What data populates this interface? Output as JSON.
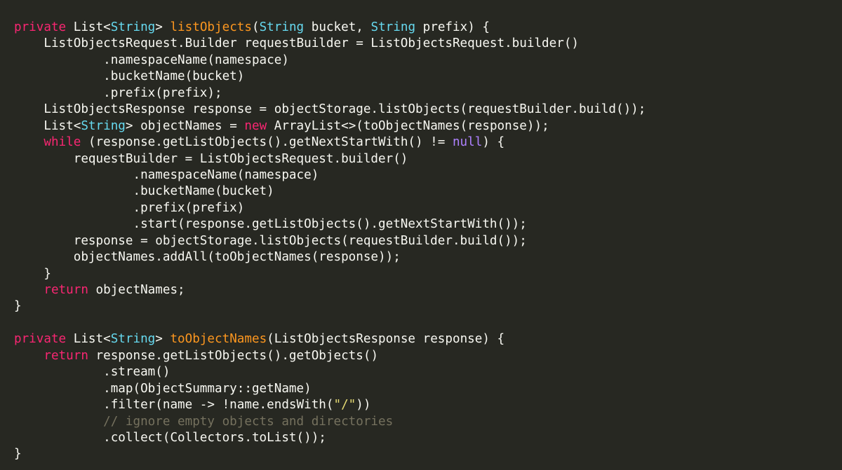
{
  "editor": {
    "language": "java",
    "theme_colors": {
      "background": "#272822",
      "plain": "#f8f8f2",
      "keyword": "#f92672",
      "type": "#66d9ef",
      "function": "#fd971f",
      "literal": "#ae81ff",
      "string": "#e6db74",
      "comment": "#75715e"
    },
    "lines": [
      [
        {
          "t": "kw",
          "v": "private"
        },
        {
          "t": "plain",
          "v": " List<"
        },
        {
          "t": "type",
          "v": "String"
        },
        {
          "t": "plain",
          "v": "> "
        },
        {
          "t": "fn",
          "v": "listObjects"
        },
        {
          "t": "plain",
          "v": "("
        },
        {
          "t": "type",
          "v": "String"
        },
        {
          "t": "plain",
          "v": " bucket, "
        },
        {
          "t": "type",
          "v": "String"
        },
        {
          "t": "plain",
          "v": " prefix) {"
        }
      ],
      [
        {
          "t": "plain",
          "v": "    ListObjectsRequest.Builder requestBuilder = ListObjectsRequest.builder()"
        }
      ],
      [
        {
          "t": "plain",
          "v": "            .namespaceName(namespace)"
        }
      ],
      [
        {
          "t": "plain",
          "v": "            .bucketName(bucket)"
        }
      ],
      [
        {
          "t": "plain",
          "v": "            .prefix(prefix);"
        }
      ],
      [
        {
          "t": "plain",
          "v": "    ListObjectsResponse response = objectStorage.listObjects(requestBuilder.build());"
        }
      ],
      [
        {
          "t": "plain",
          "v": "    List<"
        },
        {
          "t": "type",
          "v": "String"
        },
        {
          "t": "plain",
          "v": "> objectNames = "
        },
        {
          "t": "kw",
          "v": "new"
        },
        {
          "t": "plain",
          "v": " ArrayList<>(toObjectNames(response));"
        }
      ],
      [
        {
          "t": "plain",
          "v": "    "
        },
        {
          "t": "kw",
          "v": "while"
        },
        {
          "t": "plain",
          "v": " (response.getListObjects().getNextStartWith() != "
        },
        {
          "t": "lit",
          "v": "null"
        },
        {
          "t": "plain",
          "v": ") {"
        }
      ],
      [
        {
          "t": "plain",
          "v": "        requestBuilder = ListObjectsRequest.builder()"
        }
      ],
      [
        {
          "t": "plain",
          "v": "                .namespaceName(namespace)"
        }
      ],
      [
        {
          "t": "plain",
          "v": "                .bucketName(bucket)"
        }
      ],
      [
        {
          "t": "plain",
          "v": "                .prefix(prefix)"
        }
      ],
      [
        {
          "t": "plain",
          "v": "                .start(response.getListObjects().getNextStartWith());"
        }
      ],
      [
        {
          "t": "plain",
          "v": "        response = objectStorage.listObjects(requestBuilder.build());"
        }
      ],
      [
        {
          "t": "plain",
          "v": "        objectNames.addAll(toObjectNames(response));"
        }
      ],
      [
        {
          "t": "plain",
          "v": "    }"
        }
      ],
      [
        {
          "t": "plain",
          "v": "    "
        },
        {
          "t": "kw",
          "v": "return"
        },
        {
          "t": "plain",
          "v": " objectNames;"
        }
      ],
      [
        {
          "t": "plain",
          "v": "}"
        }
      ],
      [],
      [
        {
          "t": "kw",
          "v": "private"
        },
        {
          "t": "plain",
          "v": " List<"
        },
        {
          "t": "type",
          "v": "String"
        },
        {
          "t": "plain",
          "v": "> "
        },
        {
          "t": "fn",
          "v": "toObjectNames"
        },
        {
          "t": "plain",
          "v": "(ListObjectsResponse response) {"
        }
      ],
      [
        {
          "t": "plain",
          "v": "    "
        },
        {
          "t": "kw",
          "v": "return"
        },
        {
          "t": "plain",
          "v": " response.getListObjects().getObjects()"
        }
      ],
      [
        {
          "t": "plain",
          "v": "            .stream()"
        }
      ],
      [
        {
          "t": "plain",
          "v": "            .map(ObjectSummary::getName)"
        }
      ],
      [
        {
          "t": "plain",
          "v": "            .filter(name -> !name.endsWith("
        },
        {
          "t": "str",
          "v": "\"/\""
        },
        {
          "t": "plain",
          "v": "))"
        }
      ],
      [
        {
          "t": "plain",
          "v": "            "
        },
        {
          "t": "cm",
          "v": "// ignore empty objects and directories"
        }
      ],
      [
        {
          "t": "plain",
          "v": "            .collect(Collectors.toList());"
        }
      ],
      [
        {
          "t": "plain",
          "v": "}"
        }
      ]
    ]
  }
}
